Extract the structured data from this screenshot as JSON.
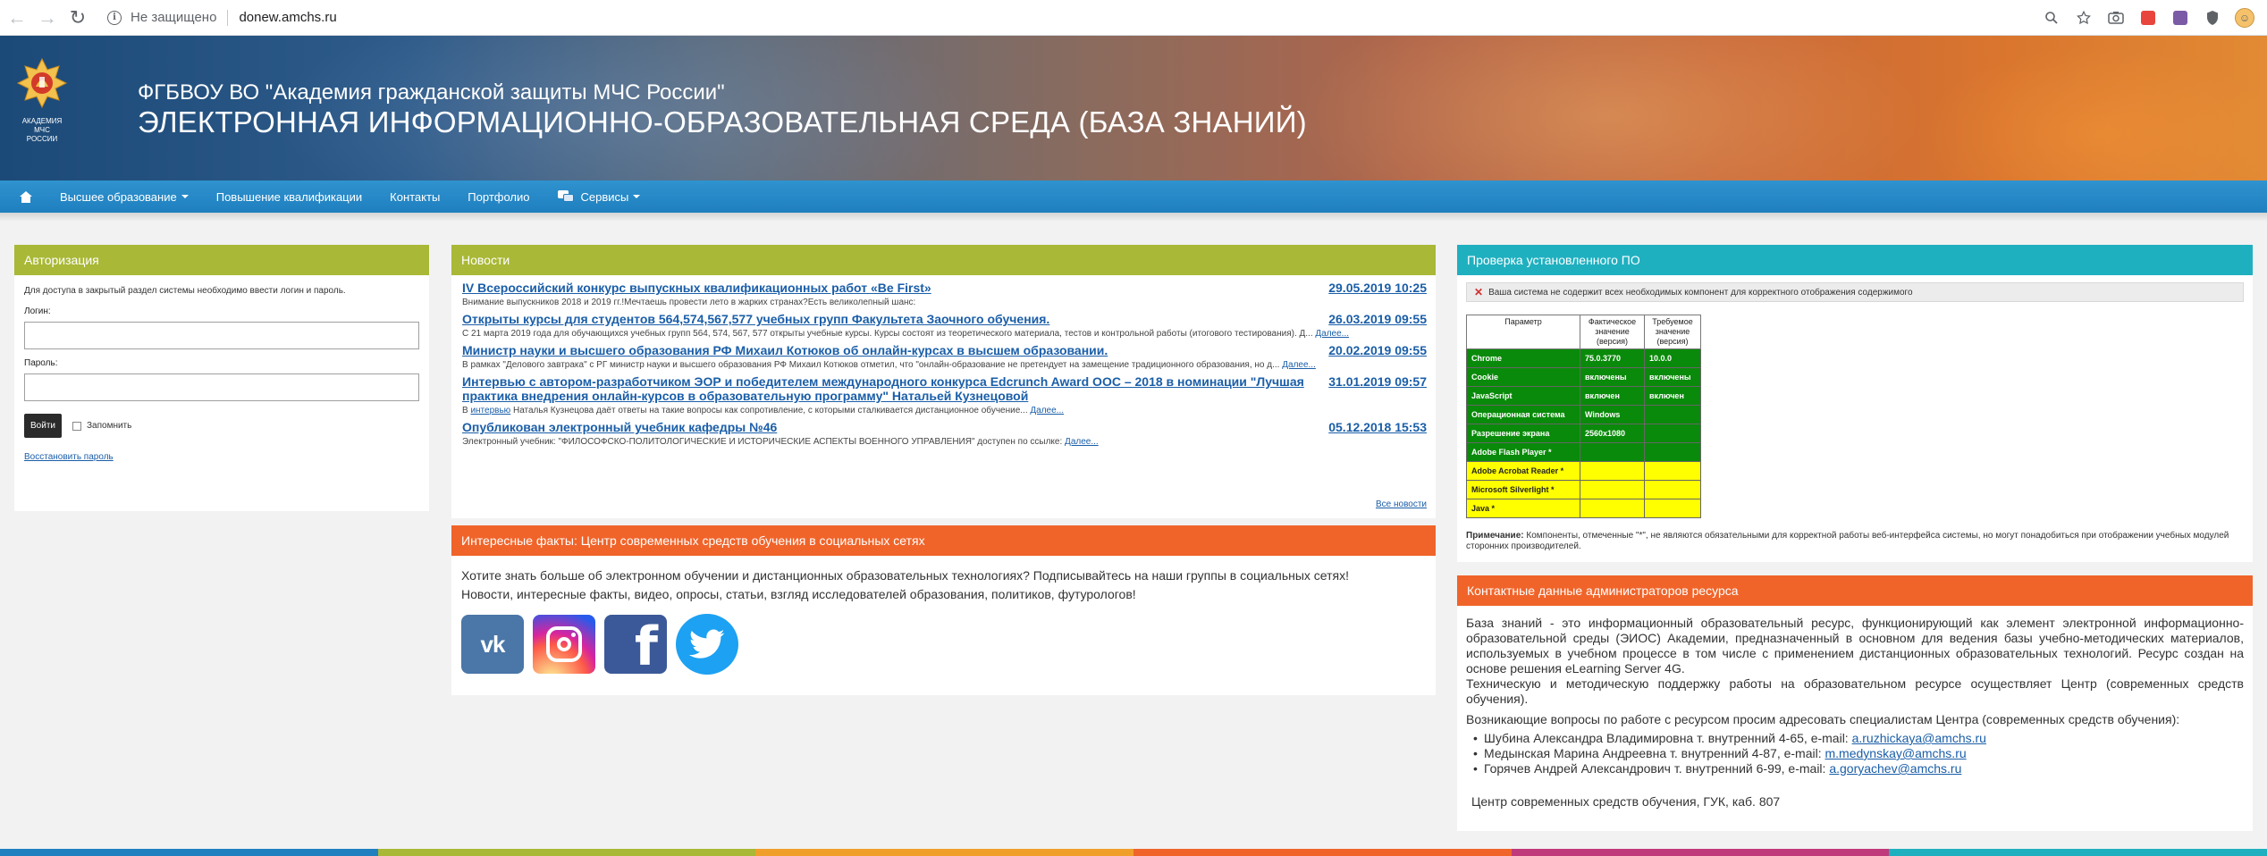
{
  "browser": {
    "back_glyph": "←",
    "forward_glyph": "→",
    "reload_glyph": "↻",
    "info_glyph": "i",
    "not_secure": "Не защищено",
    "url": "donew.amchs.ru",
    "icons": [
      "zoom-icon",
      "bookmark-star-icon",
      "screenshot-icon",
      "extension-icon",
      "extension-icon",
      "shield-icon",
      "profile-avatar"
    ]
  },
  "banner": {
    "org_name": "ФГБВОУ ВО \"Академия гражданской защиты МЧС России\"",
    "system_name": "ЭЛЕКТРОННАЯ ИНФОРМАЦИОННО-ОБРАЗОВАТЕЛЬНАЯ СРЕДА (БАЗА ЗНАНИЙ)",
    "emblem_text": "АКАДЕМИЯ МЧС РОССИИ"
  },
  "nav": {
    "items": [
      {
        "label": "Высшее образование",
        "dropdown": true
      },
      {
        "label": "Повышение квалификации",
        "dropdown": false
      },
      {
        "label": "Контакты",
        "dropdown": false
      },
      {
        "label": "Портфолио",
        "dropdown": false
      },
      {
        "label": "Сервисы",
        "dropdown": true
      }
    ]
  },
  "auth": {
    "title": "Авторизация",
    "intro": "Для доступа в закрытый раздел системы необходимо ввести логин и пароль.",
    "login_label": "Логин:",
    "login_value": "",
    "password_label": "Пароль:",
    "password_value": "",
    "login_button": "Войти",
    "remember_label": "Запомнить",
    "restore_link": "Восстановить пароль"
  },
  "news": {
    "title": "Новости",
    "items": [
      {
        "title": "IV Всероссийский конкурс выпускных квалификационных работ «Be First»",
        "date": "29.05.2019 10:25",
        "desc": "Внимание выпускников 2018 и 2019 гг.!Мечтаешь провести лето в жарких странах?Есть великолепный шанс:",
        "more": ""
      },
      {
        "title": "Открыты курсы для студентов 564,574,567,577 учебных групп Факультета Заочного обучения.",
        "date": "26.03.2019 09:55",
        "desc": "С 21 марта 2019 года для обучающихся учебных групп 564, 574, 567, 577 открыты учебные курсы. Курсы состоят из теоретического материала, тестов и контрольной работы (итогового тестирования). Д...",
        "more": "Далее..."
      },
      {
        "title": "Министр науки и высшего образования РФ Михаил Котюков об онлайн-курсах в высшем образовании.",
        "date": "20.02.2019 09:55",
        "desc": "В рамках \"Делового завтрака\" с РГ министр науки и высшего образования РФ Михаил Котюков отметил, что \"онлайн-образование не претендует на замещение традиционного образования, но д...",
        "more": "Далее..."
      },
      {
        "title": "Интервью с автором-разработчиком ЭОР и победителем международного конкурса Edcrunch Award ООС – 2018 в номинации \"Лучшая практика внедрения онлайн-курсов в образовательную программу\" Натальей Кузнецовой",
        "date": "31.01.2019 09:57",
        "desc_prefix": "В ",
        "desc_link": "интервью",
        "desc": " Наталья Кузнецова даёт ответы на такие вопросы как сопротивление, с которыми сталкивается дистанционное обучение...",
        "more": "Далее..."
      },
      {
        "title": "Опубликован электронный учебник кафедры №46",
        "date": "05.12.2018 15:53",
        "desc": "Электронный учебник: \"ФИЛОСОФСКО-ПОЛИТОЛОГИЧЕСКИЕ И ИСТОРИЧЕСКИЕ АСПЕКТЫ ВОЕННОГО УПРАВЛЕНИЯ\" доступен по ссылке:",
        "more": "Далее..."
      }
    ],
    "all_link": "Все новости"
  },
  "facts": {
    "title": "Интересные факты: Центр современных средств обучения в социальных сетях",
    "line1": "Хотите знать больше об электронном обучении и дистанционных образовательных технологиях? Подписывайтесь на наши группы в социальных сетях!",
    "line2": "Новости, интересные факты, видео, опросы, статьи, взгляд исследователей образования, политиков, футурологов!",
    "social": {
      "vk_glyph": "vk",
      "fb_glyph": "f",
      "tw_glyph": "🐦"
    }
  },
  "software": {
    "title": "Проверка установленного ПО",
    "warning": "Ваша система не содержит всех необходимых компонент для корректного отображения содержимого",
    "headers": [
      "Параметр",
      "Фактическое значение (версия)",
      "Требуемое значение (версия)"
    ],
    "rows": [
      {
        "param": "Chrome",
        "fact": "75.0.3770",
        "req": "10.0.0",
        "status": "ok"
      },
      {
        "param": "Cookie",
        "fact": "включены",
        "req": "включены",
        "status": "ok"
      },
      {
        "param": "JavaScript",
        "fact": "включен",
        "req": "включен",
        "status": "ok"
      },
      {
        "param": "Операционная система",
        "fact": "Windows",
        "req": "",
        "status": "ok"
      },
      {
        "param": "Разрешение экрана",
        "fact": "2560x1080",
        "req": "",
        "status": "ok"
      },
      {
        "param": "Adobe Flash Player *",
        "fact": "",
        "req": "",
        "status": "ok"
      },
      {
        "param": "Adobe Acrobat Reader *",
        "fact": "",
        "req": "",
        "status": "warn"
      },
      {
        "param": "Microsoft Silverlight *",
        "fact": "",
        "req": "",
        "status": "warn"
      },
      {
        "param": "Java *",
        "fact": "",
        "req": "",
        "status": "warn"
      }
    ],
    "note_label": "Примечание:",
    "note": " Компоненты, отмеченные \"*\", не являются обязательными для корректной работы веб-интерфейса системы, но могут понадобиться при отображении учебных модулей сторонних производителей.",
    "colors": {
      "ok": "#0a8a0a",
      "warn": "#ffff00"
    }
  },
  "contacts": {
    "title": "Контактные данные администраторов ресурса",
    "p1": "База знаний - это информационный образовательный ресурс, функционирующий как элемент электронной информационно-образовательной среды (ЭИОС) Академии, предназначенный в основном для ведения базы учебно-методических материалов, используемых в учебном процессе в том числе с применением дистанционных образовательных технологий. Ресурс создан на основе решения eLearning Server 4G.",
    "p2": "Техническую и методическую поддержку работы на образовательном ресурсе осуществляет Центр (современных средств обучения).",
    "p3": "Возникающие вопросы по работе с ресурсом просим адресовать специалистам Центра (современных средств обучения):",
    "people": [
      {
        "text": "Шубина Александра Владимировна т. внутренний 4-65, e-mail: ",
        "email": "a.ruzhickaya@amchs.ru"
      },
      {
        "text": "Медынская Марина Андреевна т. внутренний 4-87, e-mail: ",
        "email": "m.medynskay@amchs.ru"
      },
      {
        "text": "Горячев Андрей Александрович т. внутренний 6-99, e-mail: ",
        "email": "a.goryachev@amchs.ru"
      }
    ],
    "footer": "Центр современных средств обучения, ГУК, каб. 807"
  },
  "theme": {
    "nav_blue": "#1f7fbf",
    "olive": "#a9b836",
    "teal": "#1fb0c0",
    "orange": "#f0642a",
    "link": "#1a5ea8"
  }
}
